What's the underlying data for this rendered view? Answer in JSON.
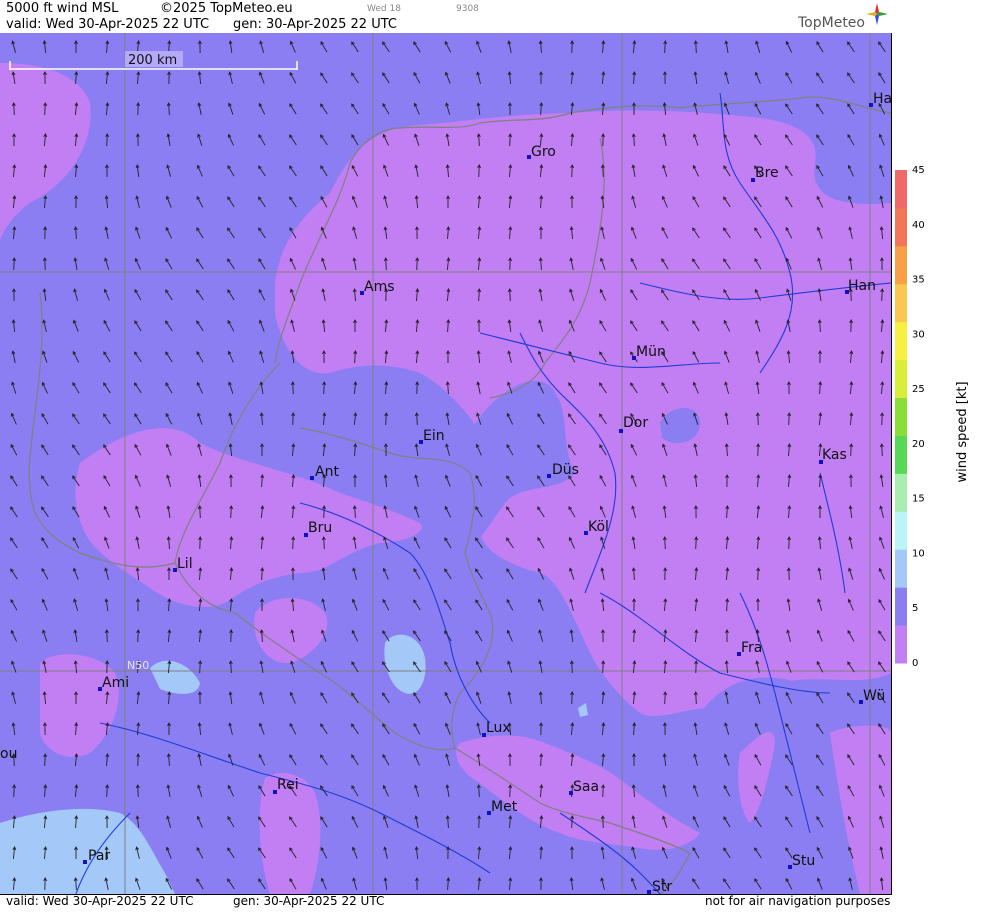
{
  "header": {
    "product": "5000 ft wind MSL",
    "copyright": "©2025 TopMeteo.eu",
    "weekday_label": "Wed 18",
    "code": "9308",
    "valid": "valid:  Wed  30-Apr-2025  22 UTC",
    "gen": "gen: 30-Apr-2025 22 UTC",
    "logo": "TopMeteo"
  },
  "footer": {
    "valid": "valid:  Wed  30-Apr-2025  22 UTC",
    "gen": "gen: 30-Apr-2025 22 UTC",
    "disclaimer": "not for air navigation purposes"
  },
  "map": {
    "scale_label": "200 km",
    "lat_label": "N50",
    "colors": {
      "light_blue": "#a4c8f8",
      "blue_purple": "#8a7ef2",
      "violet": "#c27ef3",
      "border": "#808080",
      "river": "#1e3cd8",
      "city": "#1010c8"
    },
    "cities": [
      {
        "name": "Gro"
      },
      {
        "name": "Bre"
      },
      {
        "name": "Ha"
      },
      {
        "name": "Ams"
      },
      {
        "name": "Han"
      },
      {
        "name": "Mün"
      },
      {
        "name": "Dor"
      },
      {
        "name": "Ein"
      },
      {
        "name": "Kas"
      },
      {
        "name": "Ant"
      },
      {
        "name": "Düs"
      },
      {
        "name": "Bru"
      },
      {
        "name": "Köl"
      },
      {
        "name": "Lil"
      },
      {
        "name": "Fra"
      },
      {
        "name": "Ami"
      },
      {
        "name": "Wü"
      },
      {
        "name": "ou"
      },
      {
        "name": "Lux"
      },
      {
        "name": "Rei"
      },
      {
        "name": "Saa"
      },
      {
        "name": "Met"
      },
      {
        "name": "Par"
      },
      {
        "name": "Stu"
      },
      {
        "name": "Str"
      }
    ]
  },
  "legend": {
    "title": "wind  speed  [kt]",
    "ticks": [
      "45",
      "40",
      "35",
      "30",
      "25",
      "20",
      "15",
      "10",
      "5",
      "0"
    ],
    "bands": [
      "#c27ef3",
      "#8a7ef2",
      "#a4c8f8",
      "#b8f4f8",
      "#a8eeb0",
      "#58d858",
      "#8ade38",
      "#d8ee38",
      "#f8f040",
      "#f8c850",
      "#f8a048",
      "#f07858",
      "#f06868"
    ]
  }
}
